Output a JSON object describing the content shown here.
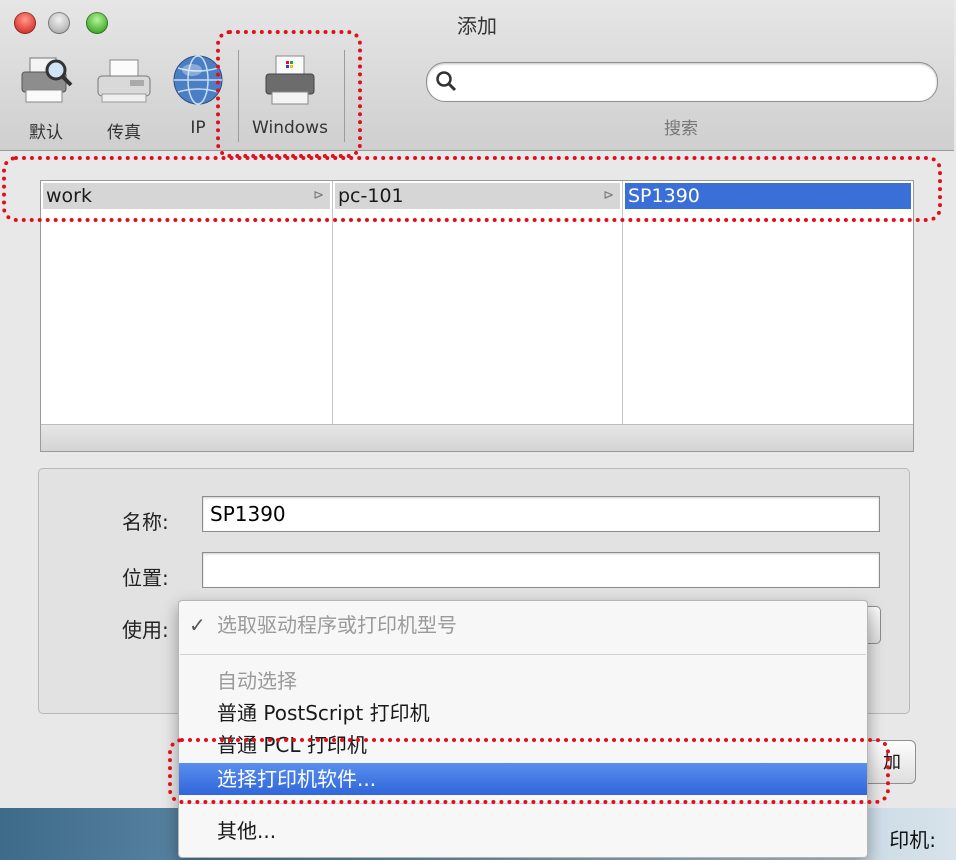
{
  "window": {
    "title": "添加"
  },
  "toolbar": {
    "items": [
      {
        "label": "默认",
        "icon": "printer-magnifier-icon"
      },
      {
        "label": "传真",
        "icon": "fax-icon"
      },
      {
        "label": "IP",
        "icon": "globe-icon"
      },
      {
        "label": "Windows",
        "icon": "windows-printer-icon"
      }
    ],
    "search": {
      "value": "",
      "label": "搜索"
    }
  },
  "browser": {
    "columns": [
      {
        "item": "work",
        "has_children": true,
        "selected": false
      },
      {
        "item": "pc-101",
        "has_children": true,
        "selected": false
      },
      {
        "item": "SP1390",
        "has_children": false,
        "selected": true
      }
    ],
    "arrow_glyph": "⊳"
  },
  "form": {
    "name_label": "名称:",
    "name_value": "SP1390",
    "location_label": "位置:",
    "location_value": "",
    "use_label": "使用:"
  },
  "use_menu": {
    "check_glyph": "✓",
    "items": [
      {
        "label": "选取驱动程序或打印机型号",
        "checked": true,
        "disabled": true
      },
      {
        "label": "自动选择",
        "disabled": true
      },
      {
        "label": "普通 PostScript 打印机"
      },
      {
        "label": "普通 PCL 打印机"
      },
      {
        "label": "选择打印机软件...",
        "highlighted": true
      },
      {
        "label": "其他..."
      }
    ]
  },
  "side_button": {
    "label": "加"
  },
  "bottom_strip": {
    "text": "印机:"
  },
  "colors": {
    "selection": "#3a6fd8",
    "menu_highlight": "#2f66d9",
    "annotation": "#e0101a"
  }
}
